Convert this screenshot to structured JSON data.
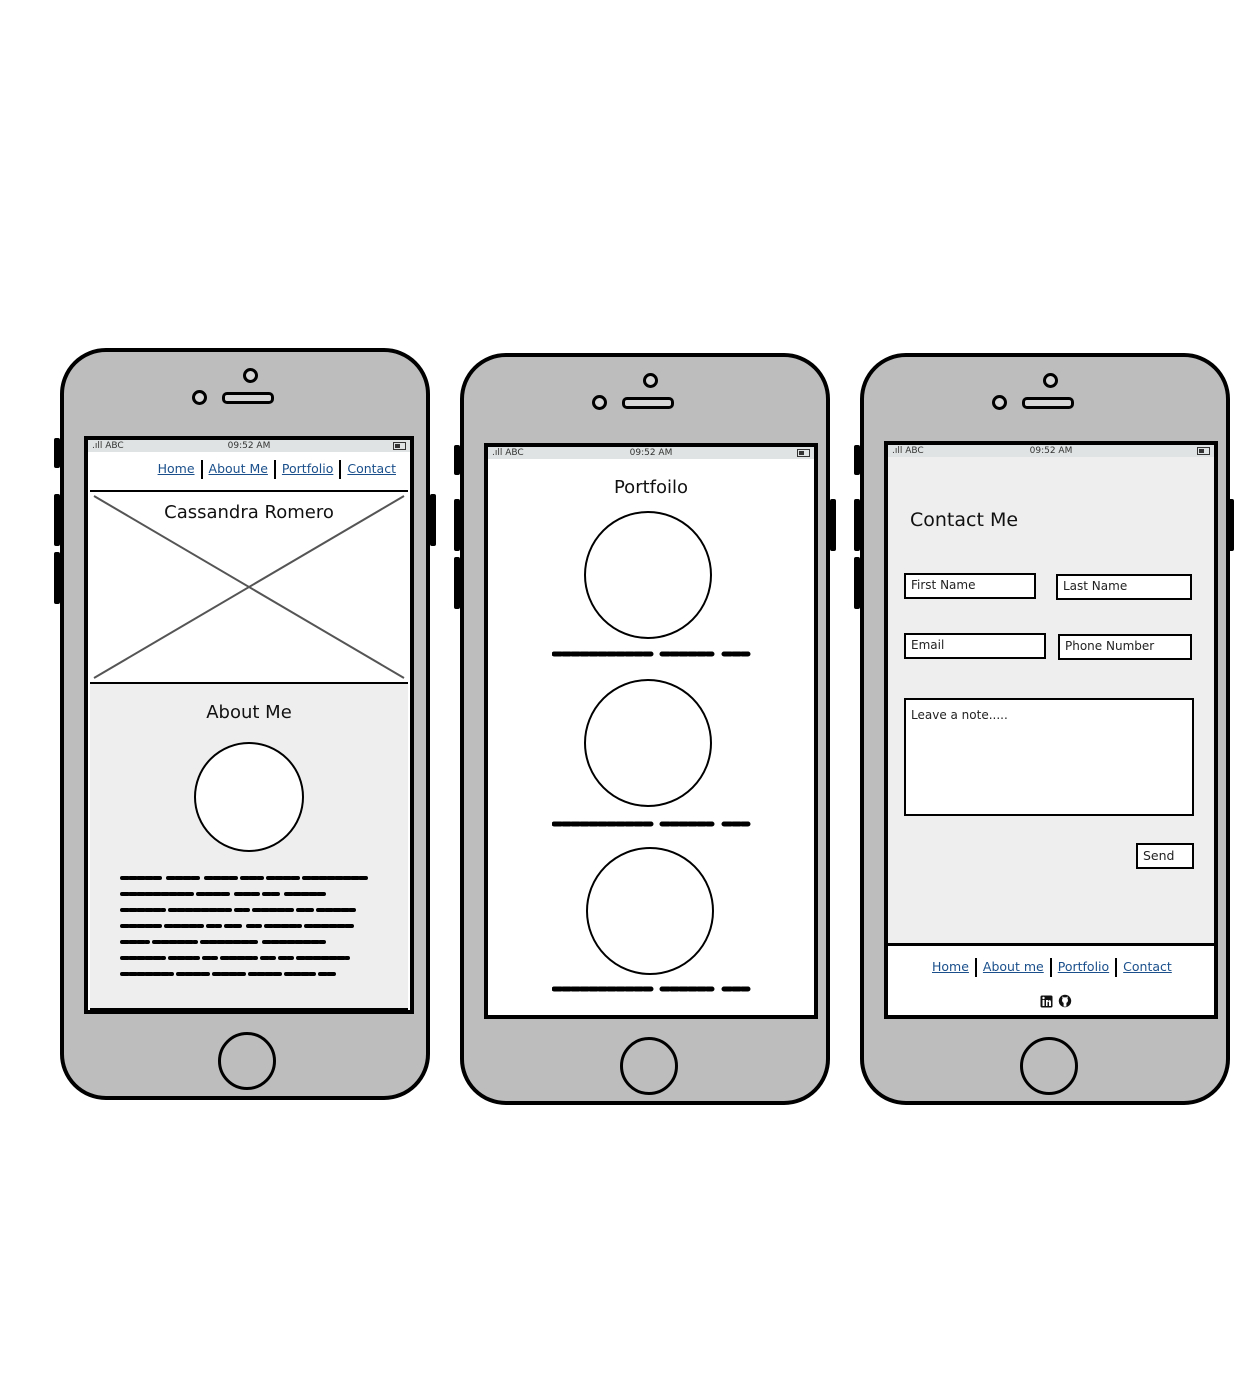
{
  "phone1": {
    "status": {
      "carrier": "ABC",
      "time": "09:52 AM"
    },
    "nav": [
      "Home",
      "About Me",
      "Portfolio",
      "Contact"
    ],
    "hero_name": "Cassandra Romero",
    "about_title": "About Me"
  },
  "phone2": {
    "status": {
      "carrier": "ABC",
      "time": "09:52 AM"
    },
    "title": "Portfoilo"
  },
  "phone3": {
    "status": {
      "carrier": "ABC",
      "time": "09:52 AM"
    },
    "title": "Contact Me",
    "fields": {
      "first_name": "First Name",
      "last_name": "Last Name",
      "email": "Email",
      "phone": "Phone Number",
      "note": "Leave a note....."
    },
    "send_label": "Send",
    "footer_nav": [
      "Home",
      "About me",
      "Portfolio",
      "Contact"
    ],
    "icons": [
      "linkedin-icon",
      "github-icon"
    ]
  },
  "colors": {
    "phone_body": "#bdbdbd",
    "screen_grey": "#eeeeee",
    "link": "#1a4f8b"
  }
}
